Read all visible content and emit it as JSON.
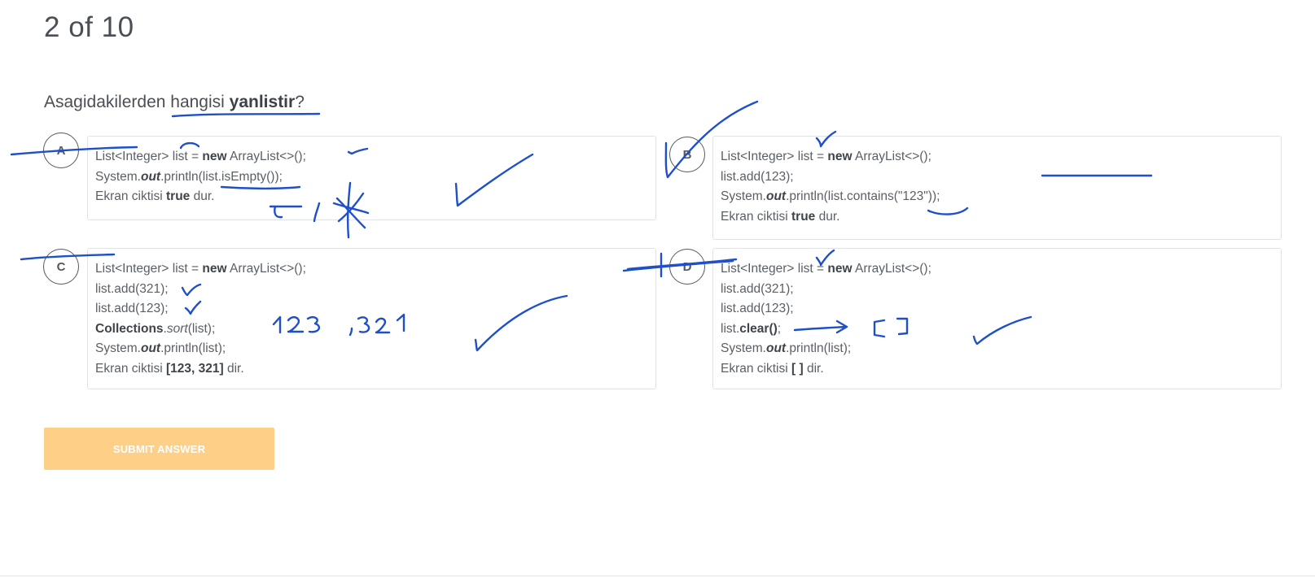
{
  "counter": "2 of 10",
  "question": {
    "prefix": "Asagidakilerden hangisi ",
    "bold": "yanlistir",
    "suffix": "?"
  },
  "options": {
    "a": {
      "letter": "A",
      "lines": [
        [
          "List<Integer> list = ",
          "new",
          " ArrayList<>();"
        ],
        [
          "System.",
          "out",
          ".println(list.isEmpty());"
        ],
        [
          "Ekran ciktisi ",
          "true",
          " dur."
        ]
      ]
    },
    "b": {
      "letter": "B",
      "lines": [
        [
          "List<Integer> list = ",
          "new",
          " ArrayList<>();"
        ],
        [
          "list.add(123);"
        ],
        [
          "System.",
          "out",
          ".println(list.contains(\"123\"));"
        ],
        [
          "Ekran ciktisi ",
          "true",
          " dur."
        ]
      ]
    },
    "c": {
      "letter": "C",
      "lines": [
        [
          "List<Integer> list = ",
          "new",
          " ArrayList<>();"
        ],
        [
          "list.add(321);"
        ],
        [
          "list.add(123);"
        ],
        [
          "Collections",
          ".",
          "sort",
          "(list);"
        ],
        [
          "System.",
          "out",
          ".println(list);"
        ],
        [
          "Ekran ciktisi ",
          "[123, 321]",
          " dir."
        ]
      ]
    },
    "d": {
      "letter": "D",
      "lines": [
        [
          "List<Integer> list = ",
          "new",
          " ArrayList<>();"
        ],
        [
          "list.add(321);"
        ],
        [
          "list.add(123);"
        ],
        [
          "list.",
          "clear()",
          ";"
        ],
        [
          "System.",
          "out",
          ".println(list);"
        ],
        [
          "Ekran ciktisi ",
          "[ ]",
          " dir."
        ]
      ]
    }
  },
  "submit_label": "SUBMIT ANSWER",
  "colors": {
    "accent_button": "#fdcf87",
    "annotation_ink": "#1f4fc9"
  }
}
